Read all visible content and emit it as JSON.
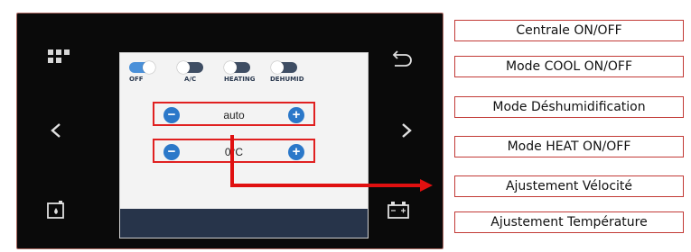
{
  "screen": {
    "toggles": [
      {
        "label": "OFF",
        "state": "on"
      },
      {
        "label": "A/C",
        "state": "off"
      },
      {
        "label": "HEATING",
        "state": "off"
      },
      {
        "label": "DEHUMID",
        "state": "off"
      }
    ],
    "speed_value": "auto",
    "temperature_value": "0°C"
  },
  "device_icons": [
    "grid-icon",
    "chevron-left-icon",
    "fuel-icon",
    "back-arrow-icon",
    "chevron-right-icon",
    "battery-icon"
  ],
  "annotations": [
    "Centrale ON/OFF",
    "Mode COOL ON/OFF",
    "Mode Déshumidification",
    "Mode HEAT ON/OFF",
    "Ajustement Vélocité",
    "Ajustement Température"
  ],
  "colors": {
    "accent_blue": "#2b78c9",
    "highlight_red": "#e02020",
    "screen_bottom": "#27344a",
    "annotation_border": "#c23a36"
  }
}
